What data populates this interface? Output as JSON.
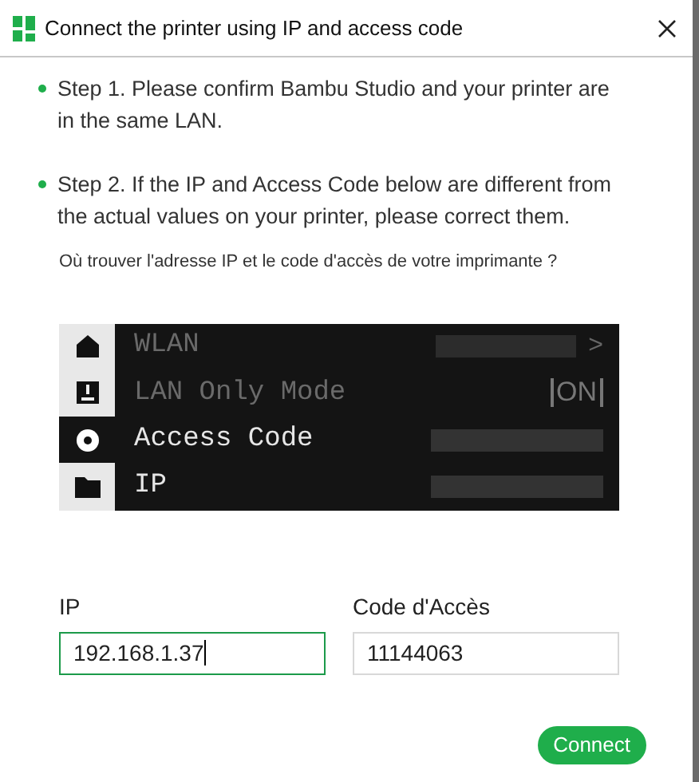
{
  "window": {
    "title": "Connect the printer using IP and access code"
  },
  "steps": [
    "Step 1. Please confirm Bambu Studio and your printer are in the same LAN.",
    "Step 2. If the IP and Access Code below are different from the actual values on your printer, please correct them."
  ],
  "help_link": "Où trouver l'adresse IP et le code d'accès de votre imprimante ?",
  "printer_screen": {
    "rows": [
      {
        "label": "WLAN",
        "selected": false,
        "disabled": true,
        "trailing": ">",
        "kind": "arrow"
      },
      {
        "label": "LAN Only Mode",
        "selected": false,
        "disabled": true,
        "trailing": "ON",
        "kind": "toggle"
      },
      {
        "label": "Access Code",
        "selected": true,
        "disabled": false,
        "kind": "value"
      },
      {
        "label": "IP",
        "selected": false,
        "disabled": false,
        "kind": "value"
      }
    ]
  },
  "fields": [
    {
      "label": "IP",
      "value": "192.168.1.37",
      "focused": true
    },
    {
      "label": "Code d'Accès",
      "value": "11144063",
      "focused": false
    }
  ],
  "buttons": [
    "Connect"
  ]
}
